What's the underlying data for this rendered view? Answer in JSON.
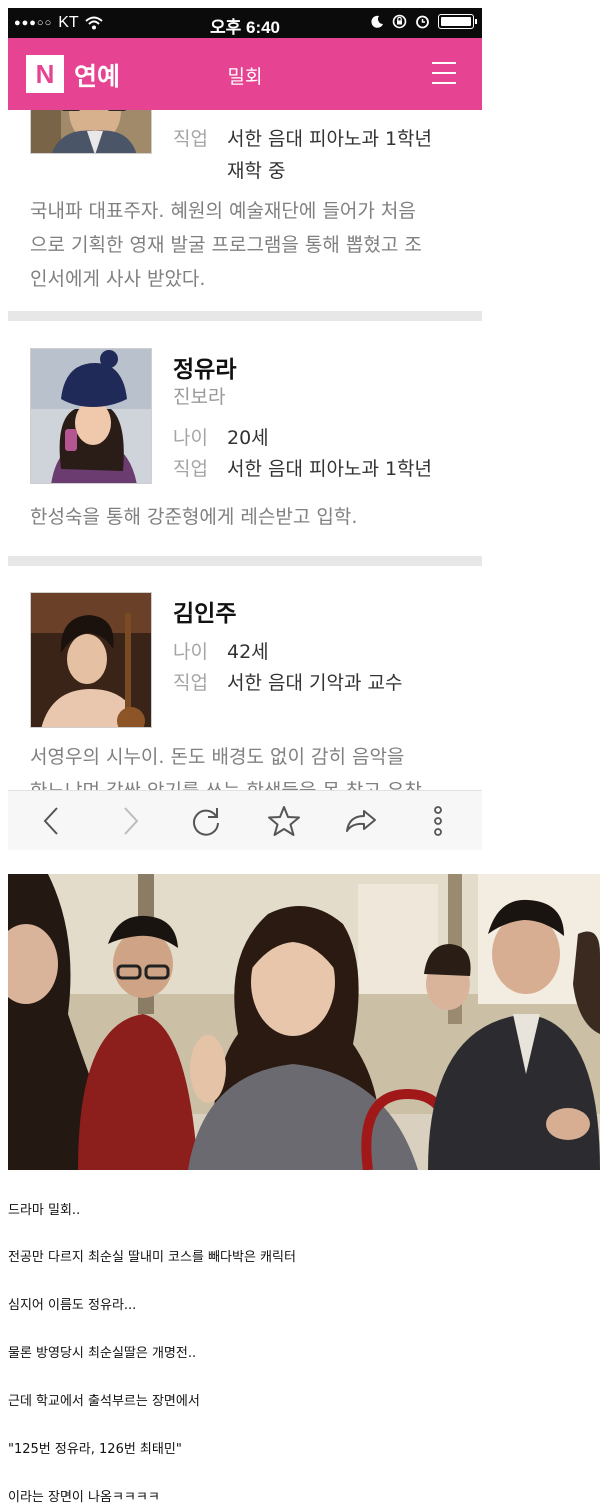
{
  "status_bar": {
    "carrier": "KT",
    "time": "오후 6:40"
  },
  "app_bar": {
    "logo_letter": "N",
    "brand": "연예",
    "title": "밀회"
  },
  "cast": [
    {
      "job_label": "직업",
      "job": "서한 음대 피아노과 1학년",
      "job_line2": "재학 중",
      "desc_lines": [
        "국내파 대표주자. 혜원의 예술재단에 들어가 처음",
        "으로 기획한 영재 발굴 프로그램을 통해 뽑혔고 조",
        "인서에게 사사 받았다."
      ]
    },
    {
      "name": "정유라",
      "role": "진보라",
      "age_label": "나이",
      "age": "20세",
      "job_label": "직업",
      "job": "서한 음대 피아노과 1학년",
      "desc_lines": [
        "한성숙을 통해 강준형에게 레슨받고 입학."
      ]
    },
    {
      "name": "김인주",
      "age_label": "나이",
      "age": "42세",
      "job_label": "직업",
      "job": "서한 음대 기악과 교수",
      "desc_lines": [
        "서영우의 시누이. 돈도 배경도 없이 감히 음악을",
        "한느냐며 갑싼 악기를 쓰는 학생들을 못 참고 유창"
      ]
    }
  ],
  "toolbar": {
    "icons": [
      "back-icon",
      "forward-icon",
      "reload-icon",
      "star-icon",
      "share-icon",
      "more-icon"
    ]
  },
  "caption_lines": [
    "드라마 밀회..",
    "전공만 다르지 최순실 딸내미 코스를 빼다박은 캐릭터",
    "심지어 이름도 정유라...",
    "물론 방영당시 최순실딸은 개명전..",
    "근데 학교에서 출석부르는 장면에서",
    "\"125번 정유라, 126번 최태민\"",
    "이라는 장면이 나옴ㅋㅋㅋㅋ"
  ],
  "colors": {
    "brand_pink": "#e64393",
    "status_bar": "#0b0b0b",
    "divider": "#e7e7e7"
  }
}
